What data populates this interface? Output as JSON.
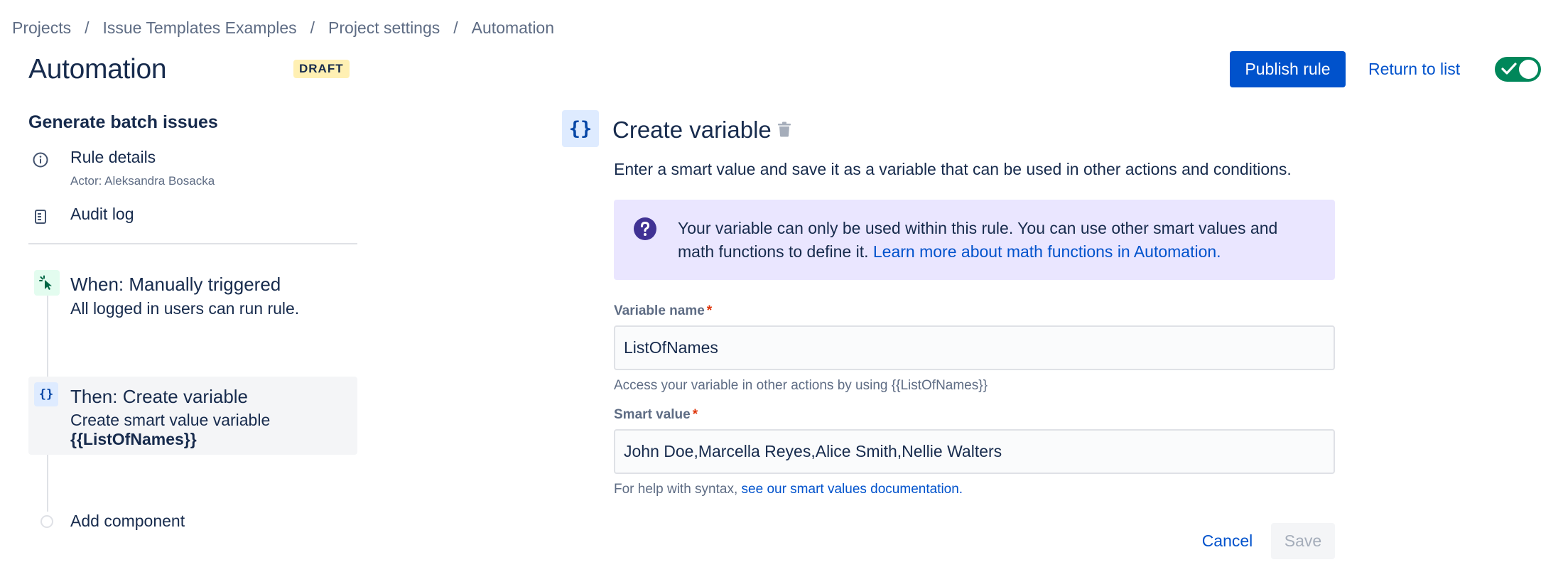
{
  "breadcrumb": [
    "Projects",
    "Issue Templates Examples",
    "Project settings",
    "Automation"
  ],
  "breadcrumb_separator": "/",
  "header": {
    "title": "Automation",
    "badge": "DRAFT",
    "publish_label": "Publish rule",
    "return_label": "Return to list",
    "toggle_enabled": true
  },
  "rule": {
    "name": "Generate batch issues",
    "details_label": "Rule details",
    "actor_text": "Actor: Aleksandra Bosacka",
    "audit_label": "Audit log"
  },
  "steps": {
    "trigger": {
      "title": "When: Manually triggered",
      "desc": "All logged in users can run rule.",
      "icon": "cursor-click-icon"
    },
    "action": {
      "title": "Then: Create variable",
      "desc": "Create smart value variable",
      "desc_bold": "{{ListOfNames}}",
      "icon": "braces-icon"
    },
    "add_label": "Add component"
  },
  "panel": {
    "icon_glyph": "{}",
    "title": "Create variable",
    "description": "Enter a smart value and save it as a variable that can be used in other actions and conditions.",
    "info_text": "Your variable can only be used within this rule. You can use other smart values and math functions to define it. ",
    "info_link": "Learn more about math functions in Automation.",
    "var_name_label": "Variable name",
    "var_name_value": "ListOfNames",
    "var_name_help": "Access your variable in other actions by using {{ListOfNames}}",
    "smart_value_label": "Smart value",
    "smart_value_value": "John Doe,Marcella Reyes,Alice Smith,Nellie Walters",
    "smart_help_prefix": "For help with syntax, ",
    "smart_help_link": "see our smart values documentation.",
    "required_mark": "*",
    "cancel_label": "Cancel",
    "save_label": "Save"
  },
  "colors": {
    "primary": "#0052cc",
    "toggle_on": "#00875a",
    "info_bg": "#eae6ff",
    "info_icon": "#403294",
    "badge_bg": "#fff0b3",
    "trigger_icon_bg": "#e3fcef",
    "action_icon_bg": "#deebff"
  }
}
